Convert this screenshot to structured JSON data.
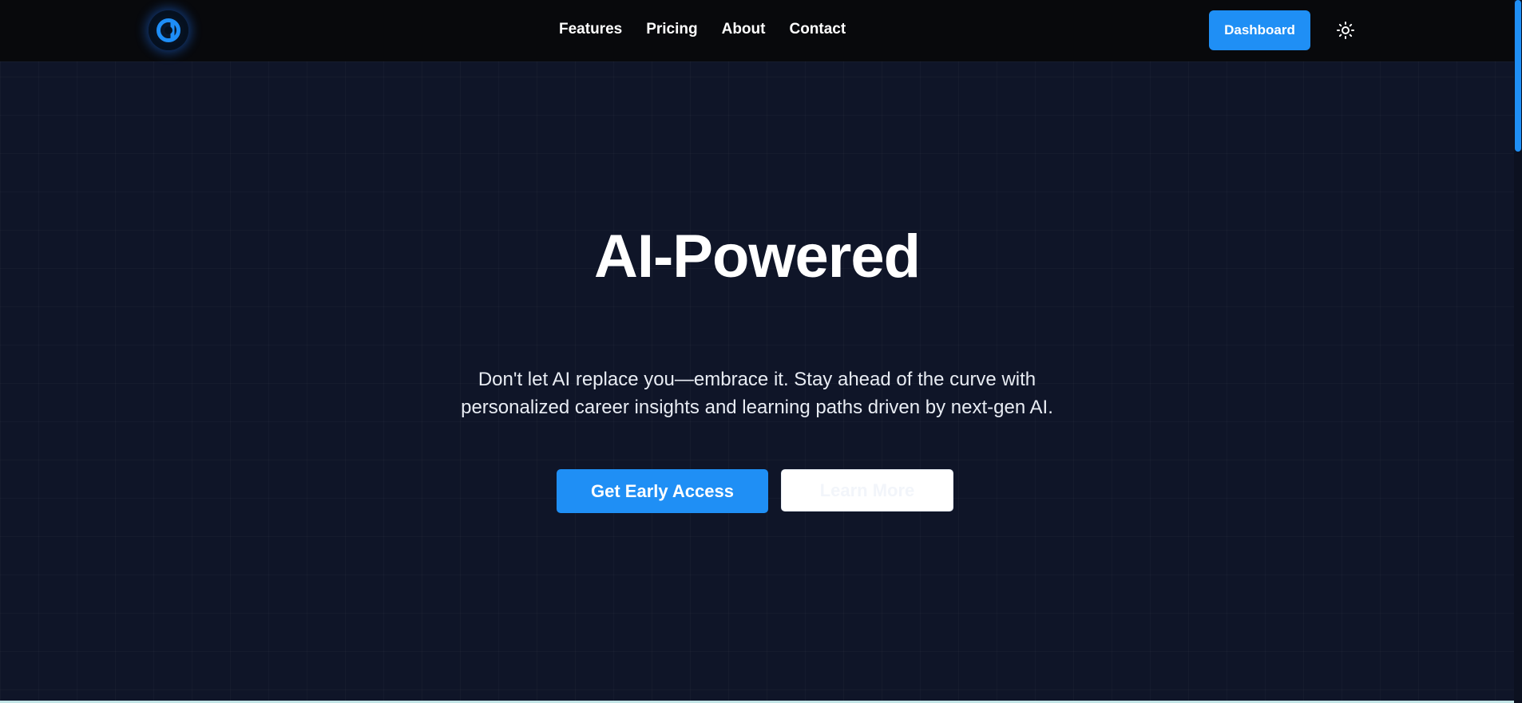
{
  "nav": {
    "logo_icon": "alpha-logo-icon",
    "links": [
      "Features",
      "Pricing",
      "About",
      "Contact"
    ],
    "dashboard_label": "Dashboard",
    "theme_toggle_icon": "sun-icon"
  },
  "hero": {
    "title": "AI-Powered",
    "subtitle": "Don't let AI replace you—embrace it. Stay ahead of the curve with personalized career insights and learning paths driven by next-gen AI.",
    "primary_cta": "Get Early Access",
    "secondary_cta": "Learn More"
  },
  "colors": {
    "background": "#0f1528",
    "navbar": "#08090c",
    "accent": "#1f8ff5",
    "text": "#ffffff"
  }
}
